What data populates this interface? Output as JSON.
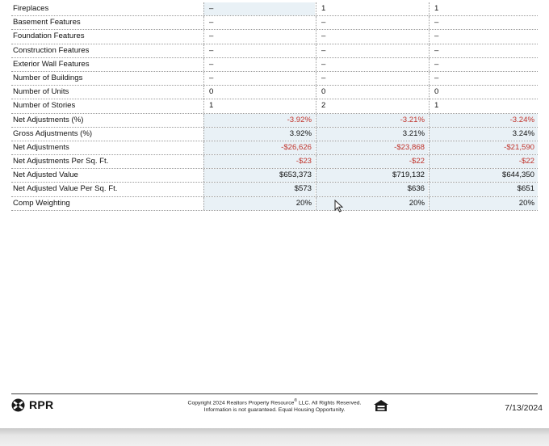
{
  "rows": [
    {
      "label": "Fireplaces",
      "c1": "–",
      "c2": "1",
      "c3": "1",
      "numeric": false,
      "neg": false,
      "shade1": true
    },
    {
      "label": "Basement Features",
      "c1": "–",
      "c2": "–",
      "c3": "–",
      "numeric": false,
      "neg": false
    },
    {
      "label": "Foundation Features",
      "c1": "–",
      "c2": "–",
      "c3": "–",
      "numeric": false,
      "neg": false
    },
    {
      "label": "Construction Features",
      "c1": "–",
      "c2": "–",
      "c3": "–",
      "numeric": false,
      "neg": false
    },
    {
      "label": "Exterior Wall Features",
      "c1": "–",
      "c2": "–",
      "c3": "–",
      "numeric": false,
      "neg": false
    },
    {
      "label": "Number of Buildings",
      "c1": "–",
      "c2": "–",
      "c3": "–",
      "numeric": false,
      "neg": false
    },
    {
      "label": "Number of Units",
      "c1": "0",
      "c2": "0",
      "c3": "0",
      "numeric": false,
      "neg": false
    },
    {
      "label": "Number of Stories",
      "c1": "1",
      "c2": "2",
      "c3": "1",
      "numeric": false,
      "neg": false
    },
    {
      "label": "Net Adjustments (%)",
      "c1": "-3.92%",
      "c2": "-3.21%",
      "c3": "-3.24%",
      "numeric": true,
      "neg": true
    },
    {
      "label": "Gross Adjustments (%)",
      "c1": "3.92%",
      "c2": "3.21%",
      "c3": "3.24%",
      "numeric": true,
      "neg": false
    },
    {
      "label": "Net Adjustments",
      "c1": "-$26,626",
      "c2": "-$23,868",
      "c3": "-$21,590",
      "numeric": true,
      "neg": true
    },
    {
      "label": "Net Adjustments Per Sq. Ft.",
      "c1": "-$23",
      "c2": "-$22",
      "c3": "-$22",
      "numeric": true,
      "neg": true
    },
    {
      "label": "Net Adjusted Value",
      "c1": "$653,373",
      "c2": "$719,132",
      "c3": "$644,350",
      "numeric": true,
      "neg": false
    },
    {
      "label": "Net Adjusted Value Per Sq. Ft.",
      "c1": "$573",
      "c2": "$636",
      "c3": "$651",
      "numeric": true,
      "neg": false
    },
    {
      "label": "Comp Weighting",
      "c1": "20%",
      "c2": "20%",
      "c3": "20%",
      "numeric": true,
      "neg": false
    }
  ],
  "colors": {
    "negative": "#c0332b",
    "shade": "#e9f1f6"
  },
  "footer": {
    "logo_text": "RPR",
    "copyright_line1": "Copyright 2024 Realtors Property Resource",
    "copyright_mark": "®",
    "copyright_line1_end": " LLC. All Rights Reserved.",
    "copyright_line2": "Information is not guaranteed. Equal Housing Opportunity.",
    "date": "7/13/2024",
    "icons": [
      "rpr-logo-icon",
      "equal-housing-icon"
    ]
  }
}
